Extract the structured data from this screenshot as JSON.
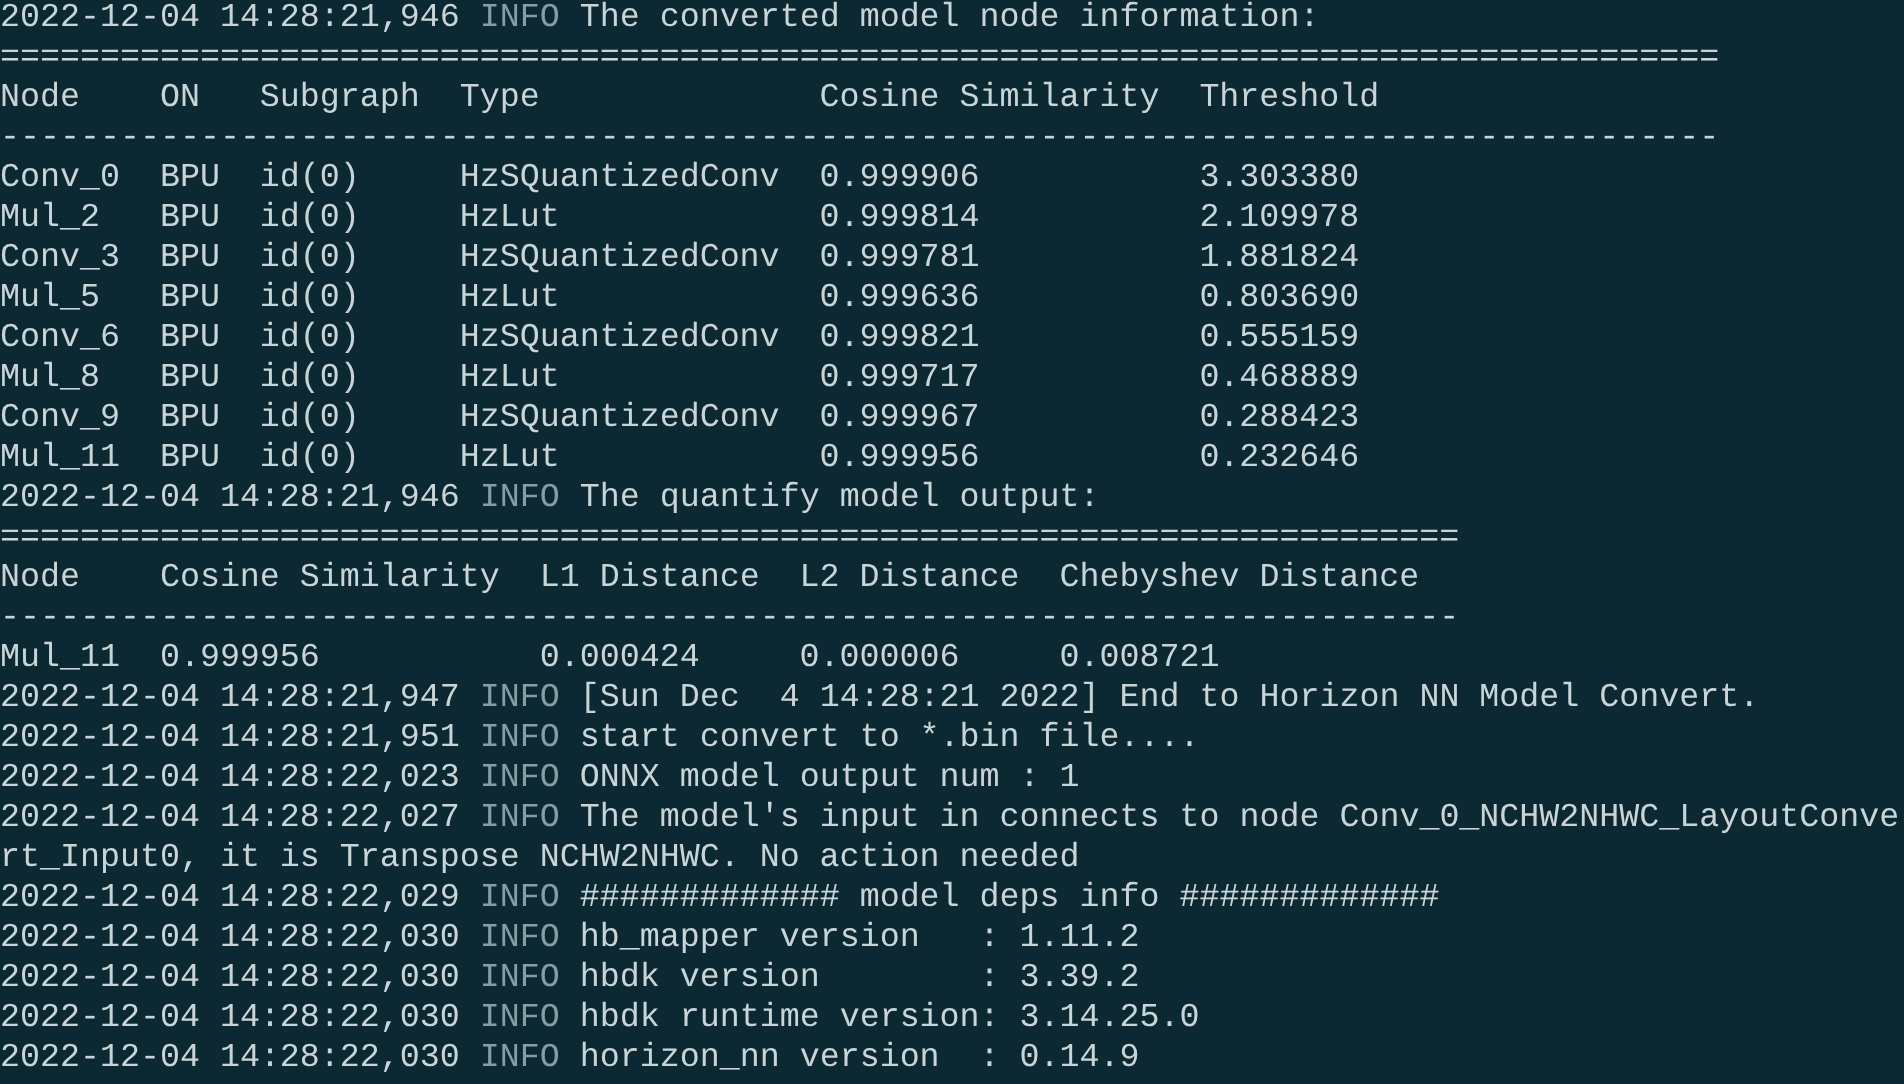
{
  "terminal": {
    "lines": [
      {
        "kind": "log",
        "timestamp": "2022-12-04 14:28:21,946",
        "level": "INFO",
        "message": "The converted model node information:"
      },
      {
        "kind": "rule",
        "text": "======================================================================================"
      },
      {
        "kind": "table",
        "columns": [
          "Node",
          "ON",
          "Subgraph",
          "Type",
          "Cosine Similarity",
          "Threshold"
        ],
        "rows": [
          [
            "Conv_0",
            "BPU",
            "id(0)",
            "HzSQuantizedConv",
            "0.999906",
            "3.303380"
          ],
          [
            "Mul_2",
            "BPU",
            "id(0)",
            "HzLut",
            "0.999814",
            "2.109978"
          ],
          [
            "Conv_3",
            "BPU",
            "id(0)",
            "HzSQuantizedConv",
            "0.999781",
            "1.881824"
          ],
          [
            "Mul_5",
            "BPU",
            "id(0)",
            "HzLut",
            "0.999636",
            "0.803690"
          ],
          [
            "Conv_6",
            "BPU",
            "id(0)",
            "HzSQuantizedConv",
            "0.999821",
            "0.555159"
          ],
          [
            "Mul_8",
            "BPU",
            "id(0)",
            "HzLut",
            "0.999717",
            "0.468889"
          ],
          [
            "Conv_9",
            "BPU",
            "id(0)",
            "HzSQuantizedConv",
            "0.999967",
            "0.288423"
          ],
          [
            "Mul_11",
            "BPU",
            "id(0)",
            "HzLut",
            "0.999956",
            "0.232646"
          ]
        ],
        "rule": "--------------------------------------------------------------------------------------"
      },
      {
        "kind": "log",
        "timestamp": "2022-12-04 14:28:21,946",
        "level": "INFO",
        "message": "The quantify model output:"
      },
      {
        "kind": "rule",
        "text": "========================================================================="
      },
      {
        "kind": "table",
        "columns": [
          "Node",
          "Cosine Similarity",
          "L1 Distance",
          "L2 Distance",
          "Chebyshev Distance"
        ],
        "rows": [
          [
            "Mul_11",
            "0.999956",
            "0.000424",
            "0.000006",
            "0.008721"
          ]
        ],
        "rule": "-------------------------------------------------------------------------"
      },
      {
        "kind": "log",
        "timestamp": "2022-12-04 14:28:21,947",
        "level": "INFO",
        "message": "[Sun Dec  4 14:28:21 2022] End to Horizon NN Model Convert."
      },
      {
        "kind": "log",
        "timestamp": "2022-12-04 14:28:21,951",
        "level": "INFO",
        "message": "start convert to *.bin file...."
      },
      {
        "kind": "log",
        "timestamp": "2022-12-04 14:28:22,023",
        "level": "INFO",
        "message": "ONNX model output num : 1"
      },
      {
        "kind": "log",
        "timestamp": "2022-12-04 14:28:22,027",
        "level": "INFO",
        "message": "The model's input in connects to node Conv_0_NCHW2NHWC_LayoutConvert_Input0, it is Transpose NCHW2NHWC. No action needed"
      },
      {
        "kind": "log",
        "timestamp": "2022-12-04 14:28:22,029",
        "level": "INFO",
        "message": "############# model deps info #############"
      },
      {
        "kind": "log",
        "timestamp": "2022-12-04 14:28:22,030",
        "level": "INFO",
        "message": "hb_mapper version   : 1.11.2"
      },
      {
        "kind": "log",
        "timestamp": "2022-12-04 14:28:22,030",
        "level": "INFO",
        "message": "hbdk version        : 3.39.2"
      },
      {
        "kind": "log",
        "timestamp": "2022-12-04 14:28:22,030",
        "level": "INFO",
        "message": "hbdk runtime version: 3.14.25.0"
      },
      {
        "kind": "log",
        "timestamp": "2022-12-04 14:28:22,030",
        "level": "INFO",
        "message": "horizon_nn version  : 0.14.9"
      }
    ]
  }
}
